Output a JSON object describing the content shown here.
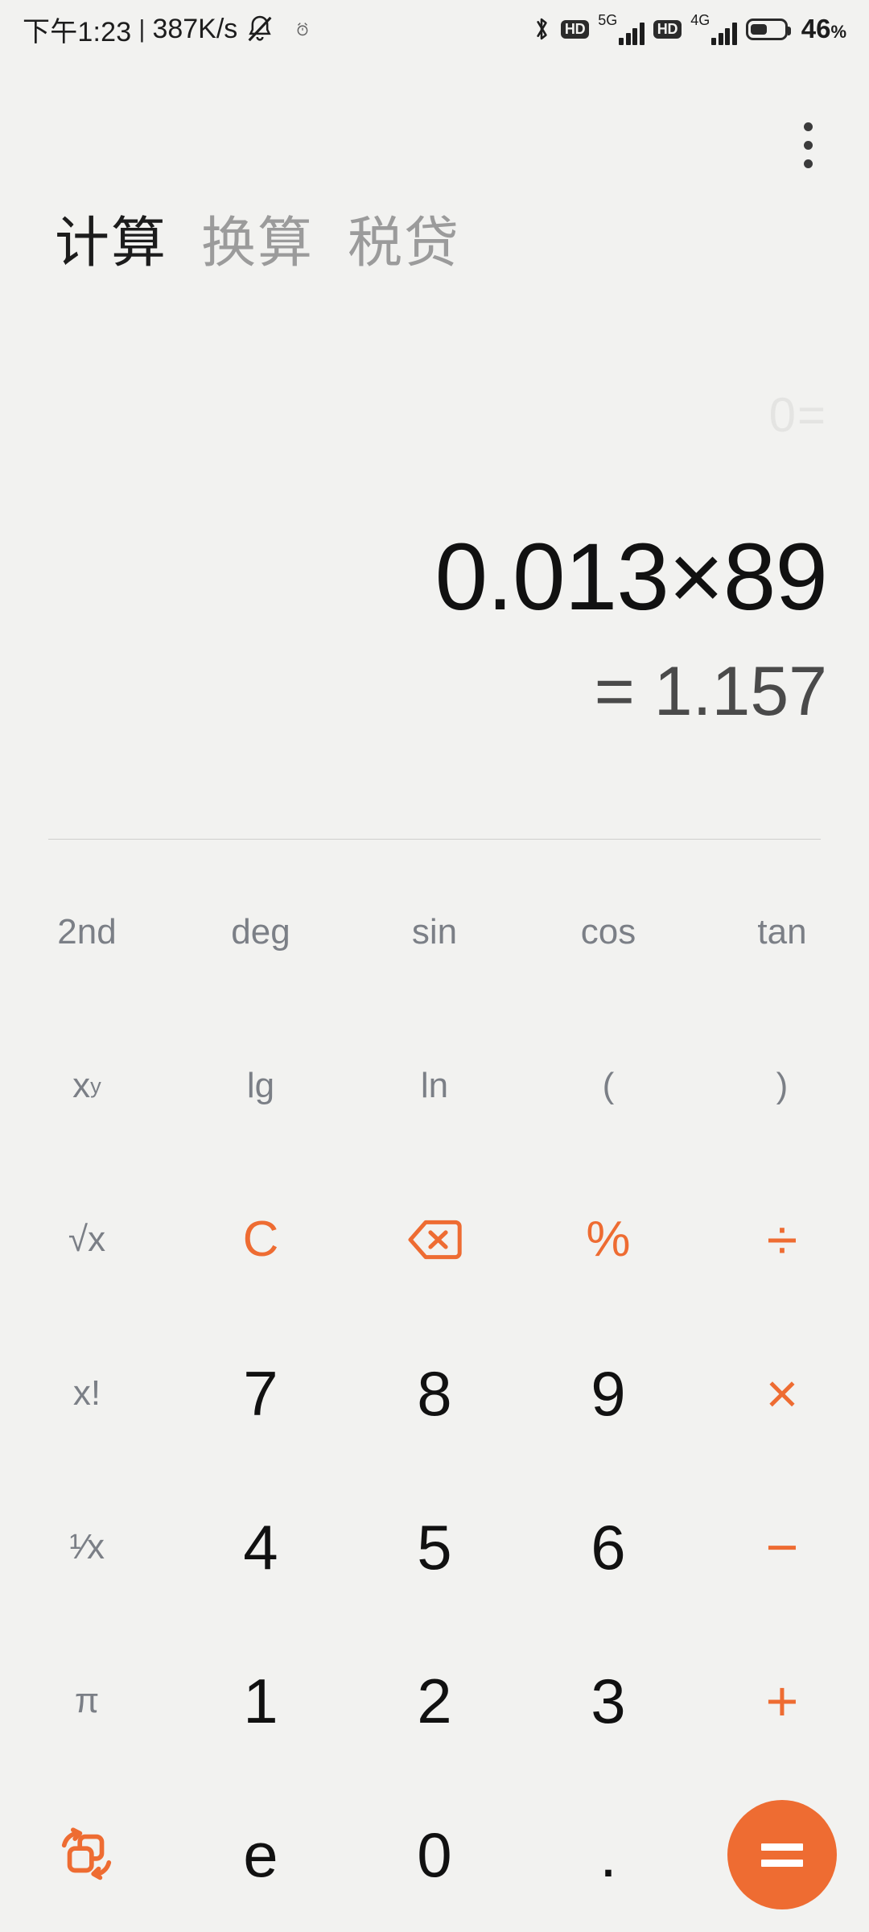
{
  "status_bar": {
    "time": "下午1:23",
    "separator": "|",
    "network_speed": "387K/s",
    "mute_icon": "mute-bell-icon",
    "secondary_icon": "alarm-icon",
    "bluetooth_icon": "bluetooth-icon",
    "hd_badge": "HD",
    "sim1_network": "5G",
    "sim2_network": "4G",
    "battery_percent": "46",
    "battery_percent_symbol": "%"
  },
  "header": {
    "overflow_menu": "more-options"
  },
  "tabs": [
    {
      "label": "计算",
      "active": true
    },
    {
      "label": "换算",
      "active": false
    },
    {
      "label": "税贷",
      "active": false
    }
  ],
  "display": {
    "history": "0=",
    "expression": "0.013×89",
    "result": "= 1.157"
  },
  "keypad": {
    "rows": [
      [
        {
          "label": "2nd",
          "name": "key-2nd",
          "style": "fn"
        },
        {
          "label": "deg",
          "name": "key-deg",
          "style": "fn"
        },
        {
          "label": "sin",
          "name": "key-sin",
          "style": "fn"
        },
        {
          "label": "cos",
          "name": "key-cos",
          "style": "fn"
        },
        {
          "label": "tan",
          "name": "key-tan",
          "style": "fn"
        }
      ],
      [
        {
          "label": "x",
          "sup": "y",
          "name": "key-power",
          "style": "fn-sup"
        },
        {
          "label": "lg",
          "name": "key-lg",
          "style": "fn"
        },
        {
          "label": "ln",
          "name": "key-ln",
          "style": "fn"
        },
        {
          "label": "(",
          "name": "key-paren-open",
          "style": "fn"
        },
        {
          "label": ")",
          "name": "key-paren-close",
          "style": "fn"
        }
      ],
      [
        {
          "label": "√x",
          "name": "key-sqrt",
          "style": "fn"
        },
        {
          "label": "C",
          "name": "key-clear",
          "style": "op"
        },
        {
          "label": "",
          "name": "key-backspace",
          "style": "icon-backspace"
        },
        {
          "label": "%",
          "name": "key-percent",
          "style": "op"
        },
        {
          "label": "÷",
          "name": "key-divide",
          "style": "op-lg"
        }
      ],
      [
        {
          "label": "x!",
          "name": "key-factorial",
          "style": "fn"
        },
        {
          "label": "7",
          "name": "key-7",
          "style": "num"
        },
        {
          "label": "8",
          "name": "key-8",
          "style": "num"
        },
        {
          "label": "9",
          "name": "key-9",
          "style": "num"
        },
        {
          "label": "×",
          "name": "key-multiply",
          "style": "op-lg"
        }
      ],
      [
        {
          "label": "¹⁄x",
          "name": "key-reciprocal",
          "style": "frac"
        },
        {
          "label": "4",
          "name": "key-4",
          "style": "num"
        },
        {
          "label": "5",
          "name": "key-5",
          "style": "num"
        },
        {
          "label": "6",
          "name": "key-6",
          "style": "num"
        },
        {
          "label": "−",
          "name": "key-minus",
          "style": "op-lg"
        }
      ],
      [
        {
          "label": "π",
          "name": "key-pi",
          "style": "fn"
        },
        {
          "label": "1",
          "name": "key-1",
          "style": "num"
        },
        {
          "label": "2",
          "name": "key-2",
          "style": "num"
        },
        {
          "label": "3",
          "name": "key-3",
          "style": "num"
        },
        {
          "label": "+",
          "name": "key-plus",
          "style": "op-lg"
        }
      ],
      [
        {
          "label": "",
          "name": "key-convert",
          "style": "icon-convert"
        },
        {
          "label": "e",
          "name": "key-e",
          "style": "num"
        },
        {
          "label": "0",
          "name": "key-0",
          "style": "num"
        },
        {
          "label": ".",
          "name": "key-decimal",
          "style": "num"
        },
        {
          "label": "=",
          "name": "key-equals",
          "style": "equals"
        }
      ]
    ]
  },
  "colors": {
    "accent": "#ee6c32",
    "background": "#f2f2f0",
    "text_primary": "#111111",
    "text_secondary": "#7b7f86",
    "text_muted": "#9b9b9b",
    "history_faint": "#e4e4e2"
  }
}
